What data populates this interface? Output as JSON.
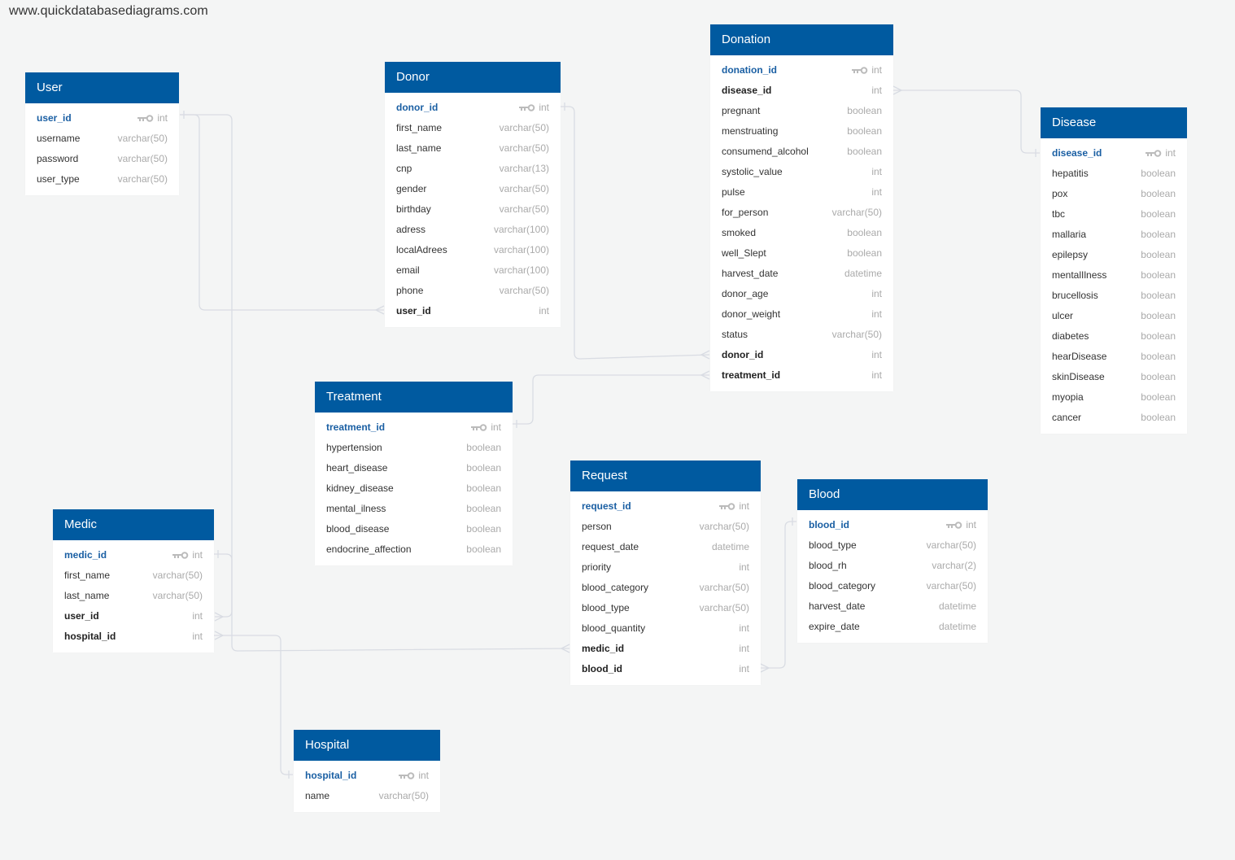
{
  "watermark": "www.quickdatabasediagrams.com",
  "colors": {
    "header": "#005aa0",
    "pk_text": "#1a5fa3",
    "link": "#d9dce3",
    "background": "#f4f5f5"
  },
  "tables": {
    "user": {
      "title": "User",
      "fields": [
        {
          "name": "user_id",
          "type": "int",
          "kind": "pk"
        },
        {
          "name": "username",
          "type": "varchar(50)",
          "kind": ""
        },
        {
          "name": "password",
          "type": "varchar(50)",
          "kind": ""
        },
        {
          "name": "user_type",
          "type": "varchar(50)",
          "kind": ""
        }
      ]
    },
    "donor": {
      "title": "Donor",
      "fields": [
        {
          "name": "donor_id",
          "type": "int",
          "kind": "pk"
        },
        {
          "name": "first_name",
          "type": "varchar(50)",
          "kind": ""
        },
        {
          "name": "last_name",
          "type": "varchar(50)",
          "kind": ""
        },
        {
          "name": "cnp",
          "type": "varchar(13)",
          "kind": ""
        },
        {
          "name": "gender",
          "type": "varchar(50)",
          "kind": ""
        },
        {
          "name": "birthday",
          "type": "varchar(50)",
          "kind": ""
        },
        {
          "name": "adress",
          "type": "varchar(100)",
          "kind": ""
        },
        {
          "name": "localAdrees",
          "type": "varchar(100)",
          "kind": ""
        },
        {
          "name": "email",
          "type": "varchar(100)",
          "kind": ""
        },
        {
          "name": "phone",
          "type": "varchar(50)",
          "kind": ""
        },
        {
          "name": "user_id",
          "type": "int",
          "kind": "fk"
        }
      ]
    },
    "donation": {
      "title": "Donation",
      "fields": [
        {
          "name": "donation_id",
          "type": "int",
          "kind": "pk"
        },
        {
          "name": "disease_id",
          "type": "int",
          "kind": "fk"
        },
        {
          "name": "pregnant",
          "type": "boolean",
          "kind": ""
        },
        {
          "name": "menstruating",
          "type": "boolean",
          "kind": ""
        },
        {
          "name": "consumend_alcohol",
          "type": "boolean",
          "kind": ""
        },
        {
          "name": "systolic_value",
          "type": "int",
          "kind": ""
        },
        {
          "name": "pulse",
          "type": "int",
          "kind": ""
        },
        {
          "name": "for_person",
          "type": "varchar(50)",
          "kind": ""
        },
        {
          "name": "smoked",
          "type": "boolean",
          "kind": ""
        },
        {
          "name": "well_Slept",
          "type": "boolean",
          "kind": ""
        },
        {
          "name": "harvest_date",
          "type": "datetime",
          "kind": ""
        },
        {
          "name": "donor_age",
          "type": "int",
          "kind": ""
        },
        {
          "name": "donor_weight",
          "type": "int",
          "kind": ""
        },
        {
          "name": "status",
          "type": "varchar(50)",
          "kind": ""
        },
        {
          "name": "donor_id",
          "type": "int",
          "kind": "fk"
        },
        {
          "name": "treatment_id",
          "type": "int",
          "kind": "fk"
        }
      ]
    },
    "disease": {
      "title": "Disease",
      "fields": [
        {
          "name": "disease_id",
          "type": "int",
          "kind": "pk"
        },
        {
          "name": "hepatitis",
          "type": "boolean",
          "kind": ""
        },
        {
          "name": "pox",
          "type": "boolean",
          "kind": ""
        },
        {
          "name": "tbc",
          "type": "boolean",
          "kind": ""
        },
        {
          "name": "mallaria",
          "type": "boolean",
          "kind": ""
        },
        {
          "name": "epilepsy",
          "type": "boolean",
          "kind": ""
        },
        {
          "name": "mentalIlness",
          "type": "boolean",
          "kind": ""
        },
        {
          "name": "brucellosis",
          "type": "boolean",
          "kind": ""
        },
        {
          "name": "ulcer",
          "type": "boolean",
          "kind": ""
        },
        {
          "name": "diabetes",
          "type": "boolean",
          "kind": ""
        },
        {
          "name": "hearDisease",
          "type": "boolean",
          "kind": ""
        },
        {
          "name": "skinDisease",
          "type": "boolean",
          "kind": ""
        },
        {
          "name": "myopia",
          "type": "boolean",
          "kind": ""
        },
        {
          "name": "cancer",
          "type": "boolean",
          "kind": ""
        }
      ]
    },
    "treatment": {
      "title": "Treatment",
      "fields": [
        {
          "name": "treatment_id",
          "type": "int",
          "kind": "pk"
        },
        {
          "name": "hypertension",
          "type": "boolean",
          "kind": ""
        },
        {
          "name": "heart_disease",
          "type": "boolean",
          "kind": ""
        },
        {
          "name": "kidney_disease",
          "type": "boolean",
          "kind": ""
        },
        {
          "name": "mental_ilness",
          "type": "boolean",
          "kind": ""
        },
        {
          "name": "blood_disease",
          "type": "boolean",
          "kind": ""
        },
        {
          "name": "endocrine_affection",
          "type": "boolean",
          "kind": ""
        }
      ]
    },
    "request": {
      "title": "Request",
      "fields": [
        {
          "name": "request_id",
          "type": "int",
          "kind": "pk"
        },
        {
          "name": "person",
          "type": "varchar(50)",
          "kind": ""
        },
        {
          "name": "request_date",
          "type": "datetime",
          "kind": ""
        },
        {
          "name": "priority",
          "type": "int",
          "kind": ""
        },
        {
          "name": "blood_category",
          "type": "varchar(50)",
          "kind": ""
        },
        {
          "name": "blood_type",
          "type": "varchar(50)",
          "kind": ""
        },
        {
          "name": "blood_quantity",
          "type": "int",
          "kind": ""
        },
        {
          "name": "medic_id",
          "type": "int",
          "kind": "fk"
        },
        {
          "name": "blood_id",
          "type": "int",
          "kind": "fk"
        }
      ]
    },
    "blood": {
      "title": "Blood",
      "fields": [
        {
          "name": "blood_id",
          "type": "int",
          "kind": "pk"
        },
        {
          "name": "blood_type",
          "type": "varchar(50)",
          "kind": ""
        },
        {
          "name": "blood_rh",
          "type": "varchar(2)",
          "kind": ""
        },
        {
          "name": "blood_category",
          "type": "varchar(50)",
          "kind": ""
        },
        {
          "name": "harvest_date",
          "type": "datetime",
          "kind": ""
        },
        {
          "name": "expire_date",
          "type": "datetime",
          "kind": ""
        }
      ]
    },
    "medic": {
      "title": "Medic",
      "fields": [
        {
          "name": "medic_id",
          "type": "int",
          "kind": "pk"
        },
        {
          "name": "first_name",
          "type": "varchar(50)",
          "kind": ""
        },
        {
          "name": "last_name",
          "type": "varchar(50)",
          "kind": ""
        },
        {
          "name": "user_id",
          "type": "int",
          "kind": "fk"
        },
        {
          "name": "hospital_id",
          "type": "int",
          "kind": "fk"
        }
      ]
    },
    "hospital": {
      "title": "Hospital",
      "fields": [
        {
          "name": "hospital_id",
          "type": "int",
          "kind": "pk"
        },
        {
          "name": "name",
          "type": "varchar(50)",
          "kind": ""
        }
      ]
    }
  },
  "relationships": [
    {
      "from": "donor.user_id",
      "to": "user.user_id",
      "type": "many-to-one"
    },
    {
      "from": "medic.user_id",
      "to": "user.user_id",
      "type": "many-to-one"
    },
    {
      "from": "donation.donor_id",
      "to": "donor.donor_id",
      "type": "many-to-one"
    },
    {
      "from": "donation.treatment_id",
      "to": "treatment.treatment_id",
      "type": "many-to-one"
    },
    {
      "from": "donation.disease_id",
      "to": "disease.disease_id",
      "type": "many-to-one"
    },
    {
      "from": "request.medic_id",
      "to": "medic.medic_id",
      "type": "many-to-one"
    },
    {
      "from": "request.blood_id",
      "to": "blood.blood_id",
      "type": "many-to-one"
    },
    {
      "from": "medic.hospital_id",
      "to": "hospital.hospital_id",
      "type": "many-to-one"
    }
  ]
}
